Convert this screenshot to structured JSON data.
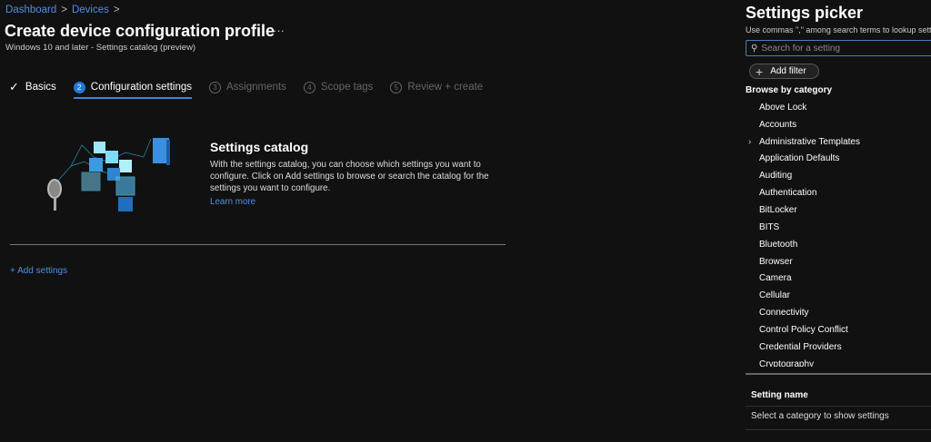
{
  "breadcrumb": [
    "Dashboard",
    "Devices"
  ],
  "header": {
    "title": "Create device configuration profile",
    "more": "···",
    "subtitle": "Windows 10 and later - Settings catalog (preview)"
  },
  "steps": [
    {
      "num": "✓",
      "label": "Basics",
      "state": "done"
    },
    {
      "num": "2",
      "label": "Configuration settings",
      "state": "active"
    },
    {
      "num": "3",
      "label": "Assignments",
      "state": "pending"
    },
    {
      "num": "4",
      "label": "Scope tags",
      "state": "pending"
    },
    {
      "num": "5",
      "label": "Review + create",
      "state": "pending"
    }
  ],
  "catalog": {
    "title": "Settings catalog",
    "description": "With the settings catalog, you can choose which settings you want to configure. Click on Add settings to browse or search the catalog for the settings you want to configure.",
    "learn_more": "Learn more",
    "add_settings": "+ Add settings"
  },
  "picker": {
    "title": "Settings picker",
    "hint": "Use commas \",\" among search terms to lookup settings",
    "search_placeholder": "Search for a setting",
    "add_filter": "Add filter",
    "browse_label": "Browse by category",
    "categories": [
      "Above Lock",
      "Accounts",
      "Administrative Templates",
      "Application Defaults",
      "Auditing",
      "Authentication",
      "BitLocker",
      "BITS",
      "Bluetooth",
      "Browser",
      "Camera",
      "Cellular",
      "Connectivity",
      "Control Policy Conflict",
      "Credential Providers",
      "Cryptography"
    ],
    "column_header": "Setting name",
    "empty_text": "Select a category to show settings"
  }
}
